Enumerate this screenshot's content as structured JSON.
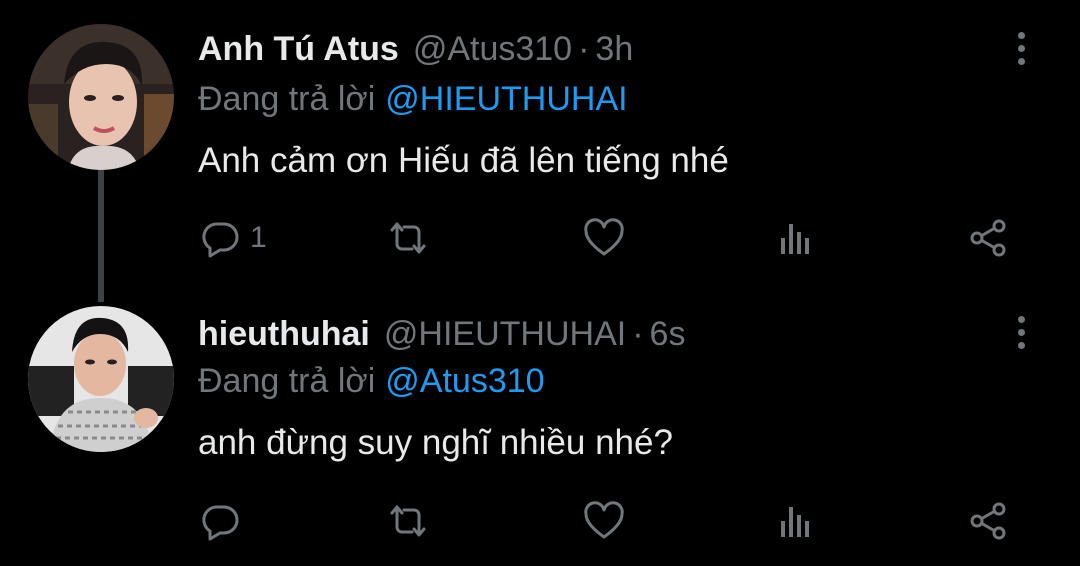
{
  "thread": {
    "tweets": [
      {
        "display_name": "Anh Tú Atus",
        "handle": "@Atus310",
        "separator": "·",
        "time": "3h",
        "reply_prefix": "Đang trả lời",
        "reply_to": "@HIEUTHUHAI",
        "text": "Anh cảm ơn Hiếu đã lên tiếng nhé",
        "reply_count": "1"
      },
      {
        "display_name": "hieuthuhai",
        "handle": "@HIEUTHUHAI",
        "separator": "·",
        "time": "6s",
        "reply_prefix": "Đang trả lời",
        "reply_to": "@Atus310",
        "text": "anh đừng suy nghĩ nhiều nhé?",
        "reply_count": ""
      }
    ]
  },
  "colors": {
    "background": "#000000",
    "primary_text": "#e7e9ea",
    "secondary_text": "#71767b",
    "accent": "#1d9bf0",
    "thread_line": "#3d4146"
  },
  "icons": [
    "reply-icon",
    "retweet-icon",
    "like-icon",
    "views-icon",
    "share-icon",
    "more-icon"
  ]
}
